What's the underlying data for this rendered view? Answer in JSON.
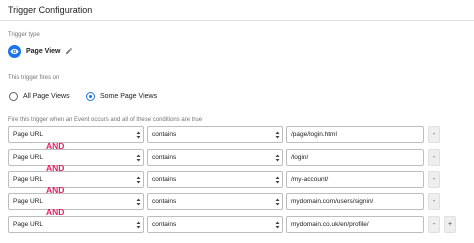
{
  "header": {
    "title": "Trigger Configuration"
  },
  "trigger_type": {
    "label": "Trigger type",
    "name": "Page View",
    "icon": "eye-icon",
    "edit_icon": "pencil-icon",
    "accent": "#1a73e8"
  },
  "fires_on": {
    "label": "This trigger fires on",
    "options": [
      {
        "label": "All Page Views",
        "checked": false
      },
      {
        "label": "Some Page Views",
        "checked": true
      }
    ]
  },
  "conditions": {
    "label": "Fire this trigger when an Event occurs and all of these conditions are true",
    "and_label": "AND",
    "and_color": "#e91e63",
    "remove_label": "-",
    "add_label": "+",
    "rows": [
      {
        "variable": "Page URL",
        "operator": "contains",
        "value": "/page/login.html"
      },
      {
        "variable": "Page URL",
        "operator": "contains",
        "value": "/login/"
      },
      {
        "variable": "Page URL",
        "operator": "contains",
        "value": "/my-account/"
      },
      {
        "variable": "Page URL",
        "operator": "contains",
        "value": "mydomain.com/users/signin/"
      },
      {
        "variable": "Page URL",
        "operator": "contains",
        "value": "mydomain.co.uk/en/profile/"
      }
    ]
  }
}
